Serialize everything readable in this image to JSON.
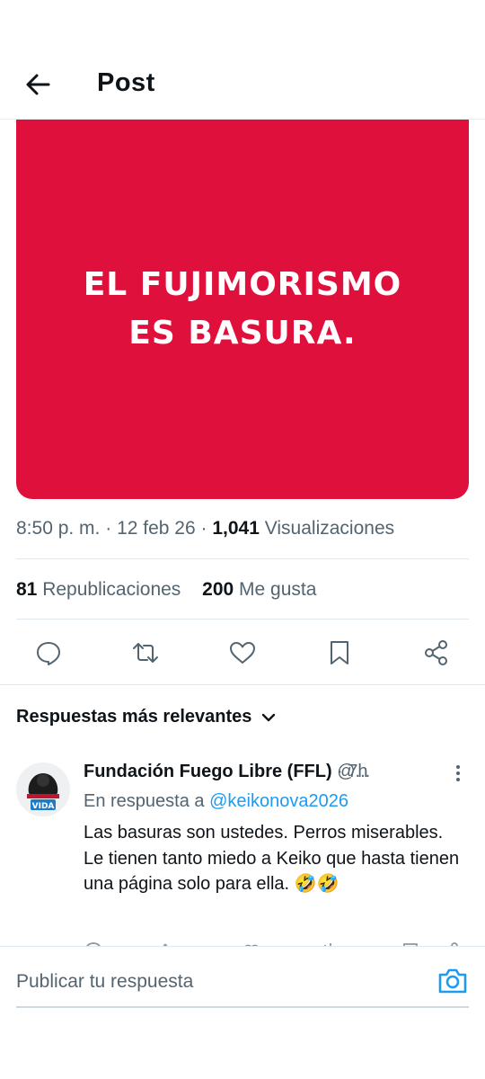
{
  "header": {
    "title": "Post"
  },
  "media": {
    "text": "EL FUJIMORISMO ES BASURA.",
    "background": "#e0103c"
  },
  "meta": {
    "time": "8:50 p. m.",
    "separator": "·",
    "date": "12 feb 26",
    "views_count": "1,041",
    "views_label": "Visualizaciones"
  },
  "stats": {
    "reposts_count": "81",
    "reposts_label": "Republicaciones",
    "likes_count": "200",
    "likes_label": "Me gusta"
  },
  "actions": [
    "reply-icon",
    "repost-icon",
    "like-icon",
    "bookmark-icon",
    "share-icon"
  ],
  "replies": {
    "sort_label": "Respuestas más relevantes",
    "items": [
      {
        "name": "Fundación Fuego Libre (FFL)",
        "handle": "@...",
        "time": "· 7h",
        "in_reply_prefix": "En respuesta a",
        "in_reply_handle": "@keikonova2026",
        "text": "Las basuras son ustedes. Perros miserables. Le tienen tanto miedo a Keiko que hasta tienen una página solo para ella. 🤣🤣"
      }
    ]
  },
  "compose": {
    "placeholder": "Publicar tu respuesta"
  },
  "colors": {
    "accent": "#1d9bf0",
    "text": "#0f1419",
    "muted": "#536471"
  }
}
